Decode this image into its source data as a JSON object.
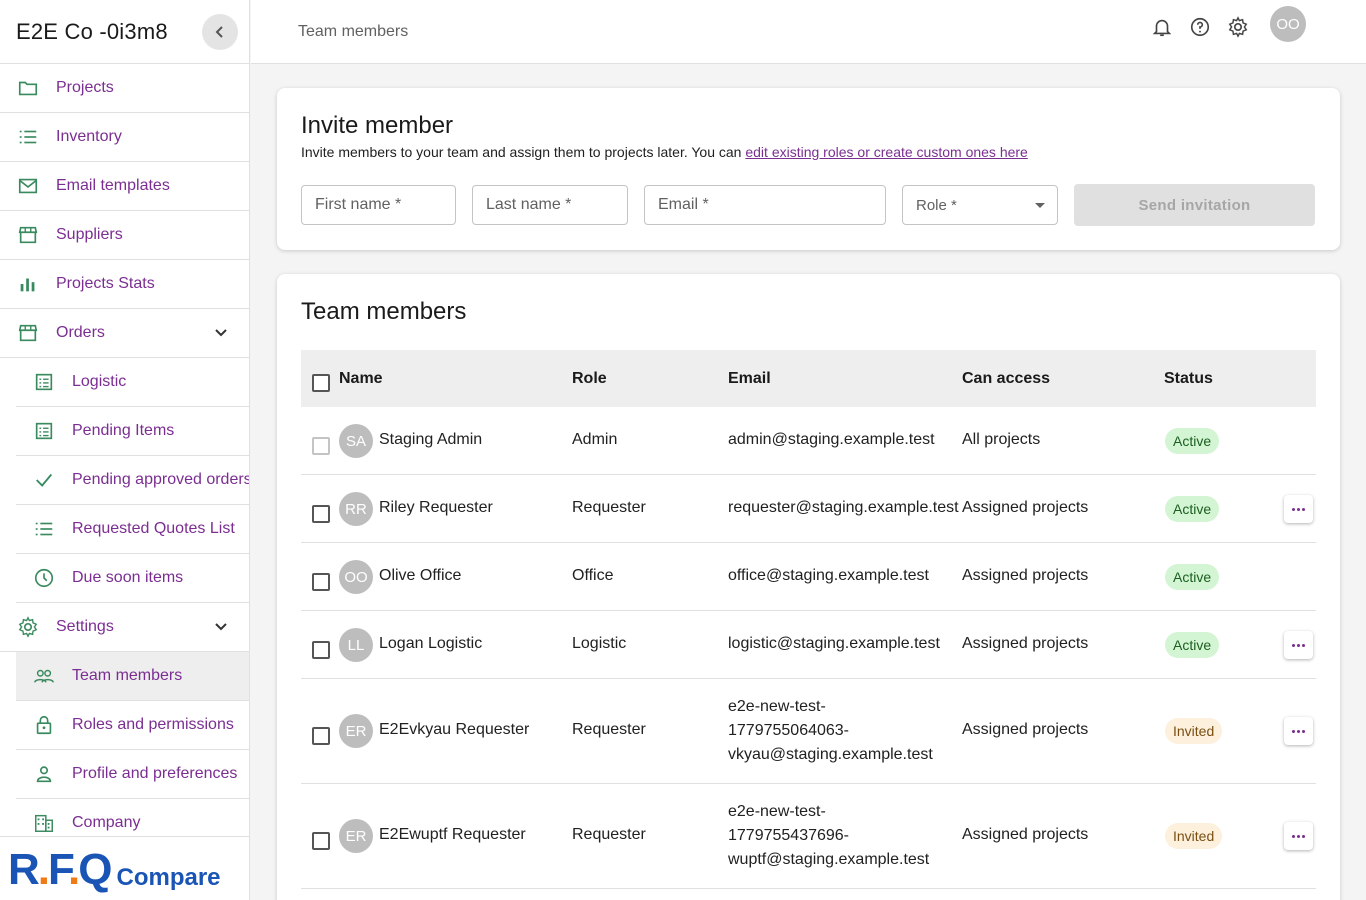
{
  "sidebar": {
    "company": "E2E Co -0i3m8",
    "items": [
      {
        "label": "Projects",
        "icon": "folder-icon"
      },
      {
        "label": "Inventory",
        "icon": "list-icon"
      },
      {
        "label": "Email templates",
        "icon": "mail-icon"
      },
      {
        "label": "Suppliers",
        "icon": "store-icon"
      },
      {
        "label": "Projects Stats",
        "icon": "bar-chart-icon"
      },
      {
        "label": "Orders",
        "icon": "store-icon"
      },
      {
        "label": "Logistic",
        "icon": "document-list-icon"
      },
      {
        "label": "Pending Items",
        "icon": "document-list-icon"
      },
      {
        "label": "Pending approved orders",
        "icon": "check-icon"
      },
      {
        "label": "Requested Quotes List",
        "icon": "list-icon"
      },
      {
        "label": "Due soon items",
        "icon": "clock-icon"
      },
      {
        "label": "Settings",
        "icon": "gear-icon"
      },
      {
        "label": "Team members",
        "icon": "people-icon"
      },
      {
        "label": "Roles and permissions",
        "icon": "lock-icon"
      },
      {
        "label": "Profile and preferences",
        "icon": "person-icon"
      },
      {
        "label": "Company",
        "icon": "building-icon"
      }
    ],
    "logo": {
      "main": "R.F.Q",
      "sub": "Compare"
    }
  },
  "topbar": {
    "title": "Team members",
    "avatar": "OO"
  },
  "invite": {
    "title": "Invite member",
    "description": "Invite members to your team and assign them to projects later. You can ",
    "link": "edit existing roles or create custom ones here",
    "first_name": "First name *",
    "last_name": "Last name *",
    "email": "Email *",
    "role": "Role *",
    "send": "Send invitation"
  },
  "team": {
    "title": "Team members",
    "columns": [
      "Name",
      "Role",
      "Email",
      "Can access",
      "Status"
    ],
    "rows": [
      {
        "initials": "SA",
        "name": "Staging Admin",
        "role": "Admin",
        "email": "admin@staging.example.test",
        "access": "All projects",
        "status": "Active"
      },
      {
        "initials": "RR",
        "name": "Riley Requester",
        "role": "Requester",
        "email": "requester@staging.example.test",
        "access": "Assigned projects",
        "status": "Active"
      },
      {
        "initials": "OO",
        "name": "Olive Office",
        "role": "Office",
        "email": "office@staging.example.test",
        "access": "Assigned projects",
        "status": "Active"
      },
      {
        "initials": "LL",
        "name": "Logan Logistic",
        "role": "Logistic",
        "email": "logistic@staging.example.test",
        "access": "Assigned projects",
        "status": "Active"
      },
      {
        "initials": "ER",
        "name": "E2Evkyau Requester",
        "role": "Requester",
        "email_lines": [
          "e2e-new-test-",
          "1779755064063-",
          "vkyau@staging.example.test"
        ],
        "access": "Assigned projects",
        "status": "Invited"
      },
      {
        "initials": "ER",
        "name": "E2Ewuptf Requester",
        "role": "Requester",
        "email_lines": [
          "e2e-new-test-",
          "1779755437696-",
          "wuptf@staging.example.test"
        ],
        "access": "Assigned projects",
        "status": "Invited"
      }
    ]
  },
  "colors": {
    "accent": "#7b2e91",
    "brand": "#1a55b6",
    "brand_orange": "#f07a16"
  }
}
